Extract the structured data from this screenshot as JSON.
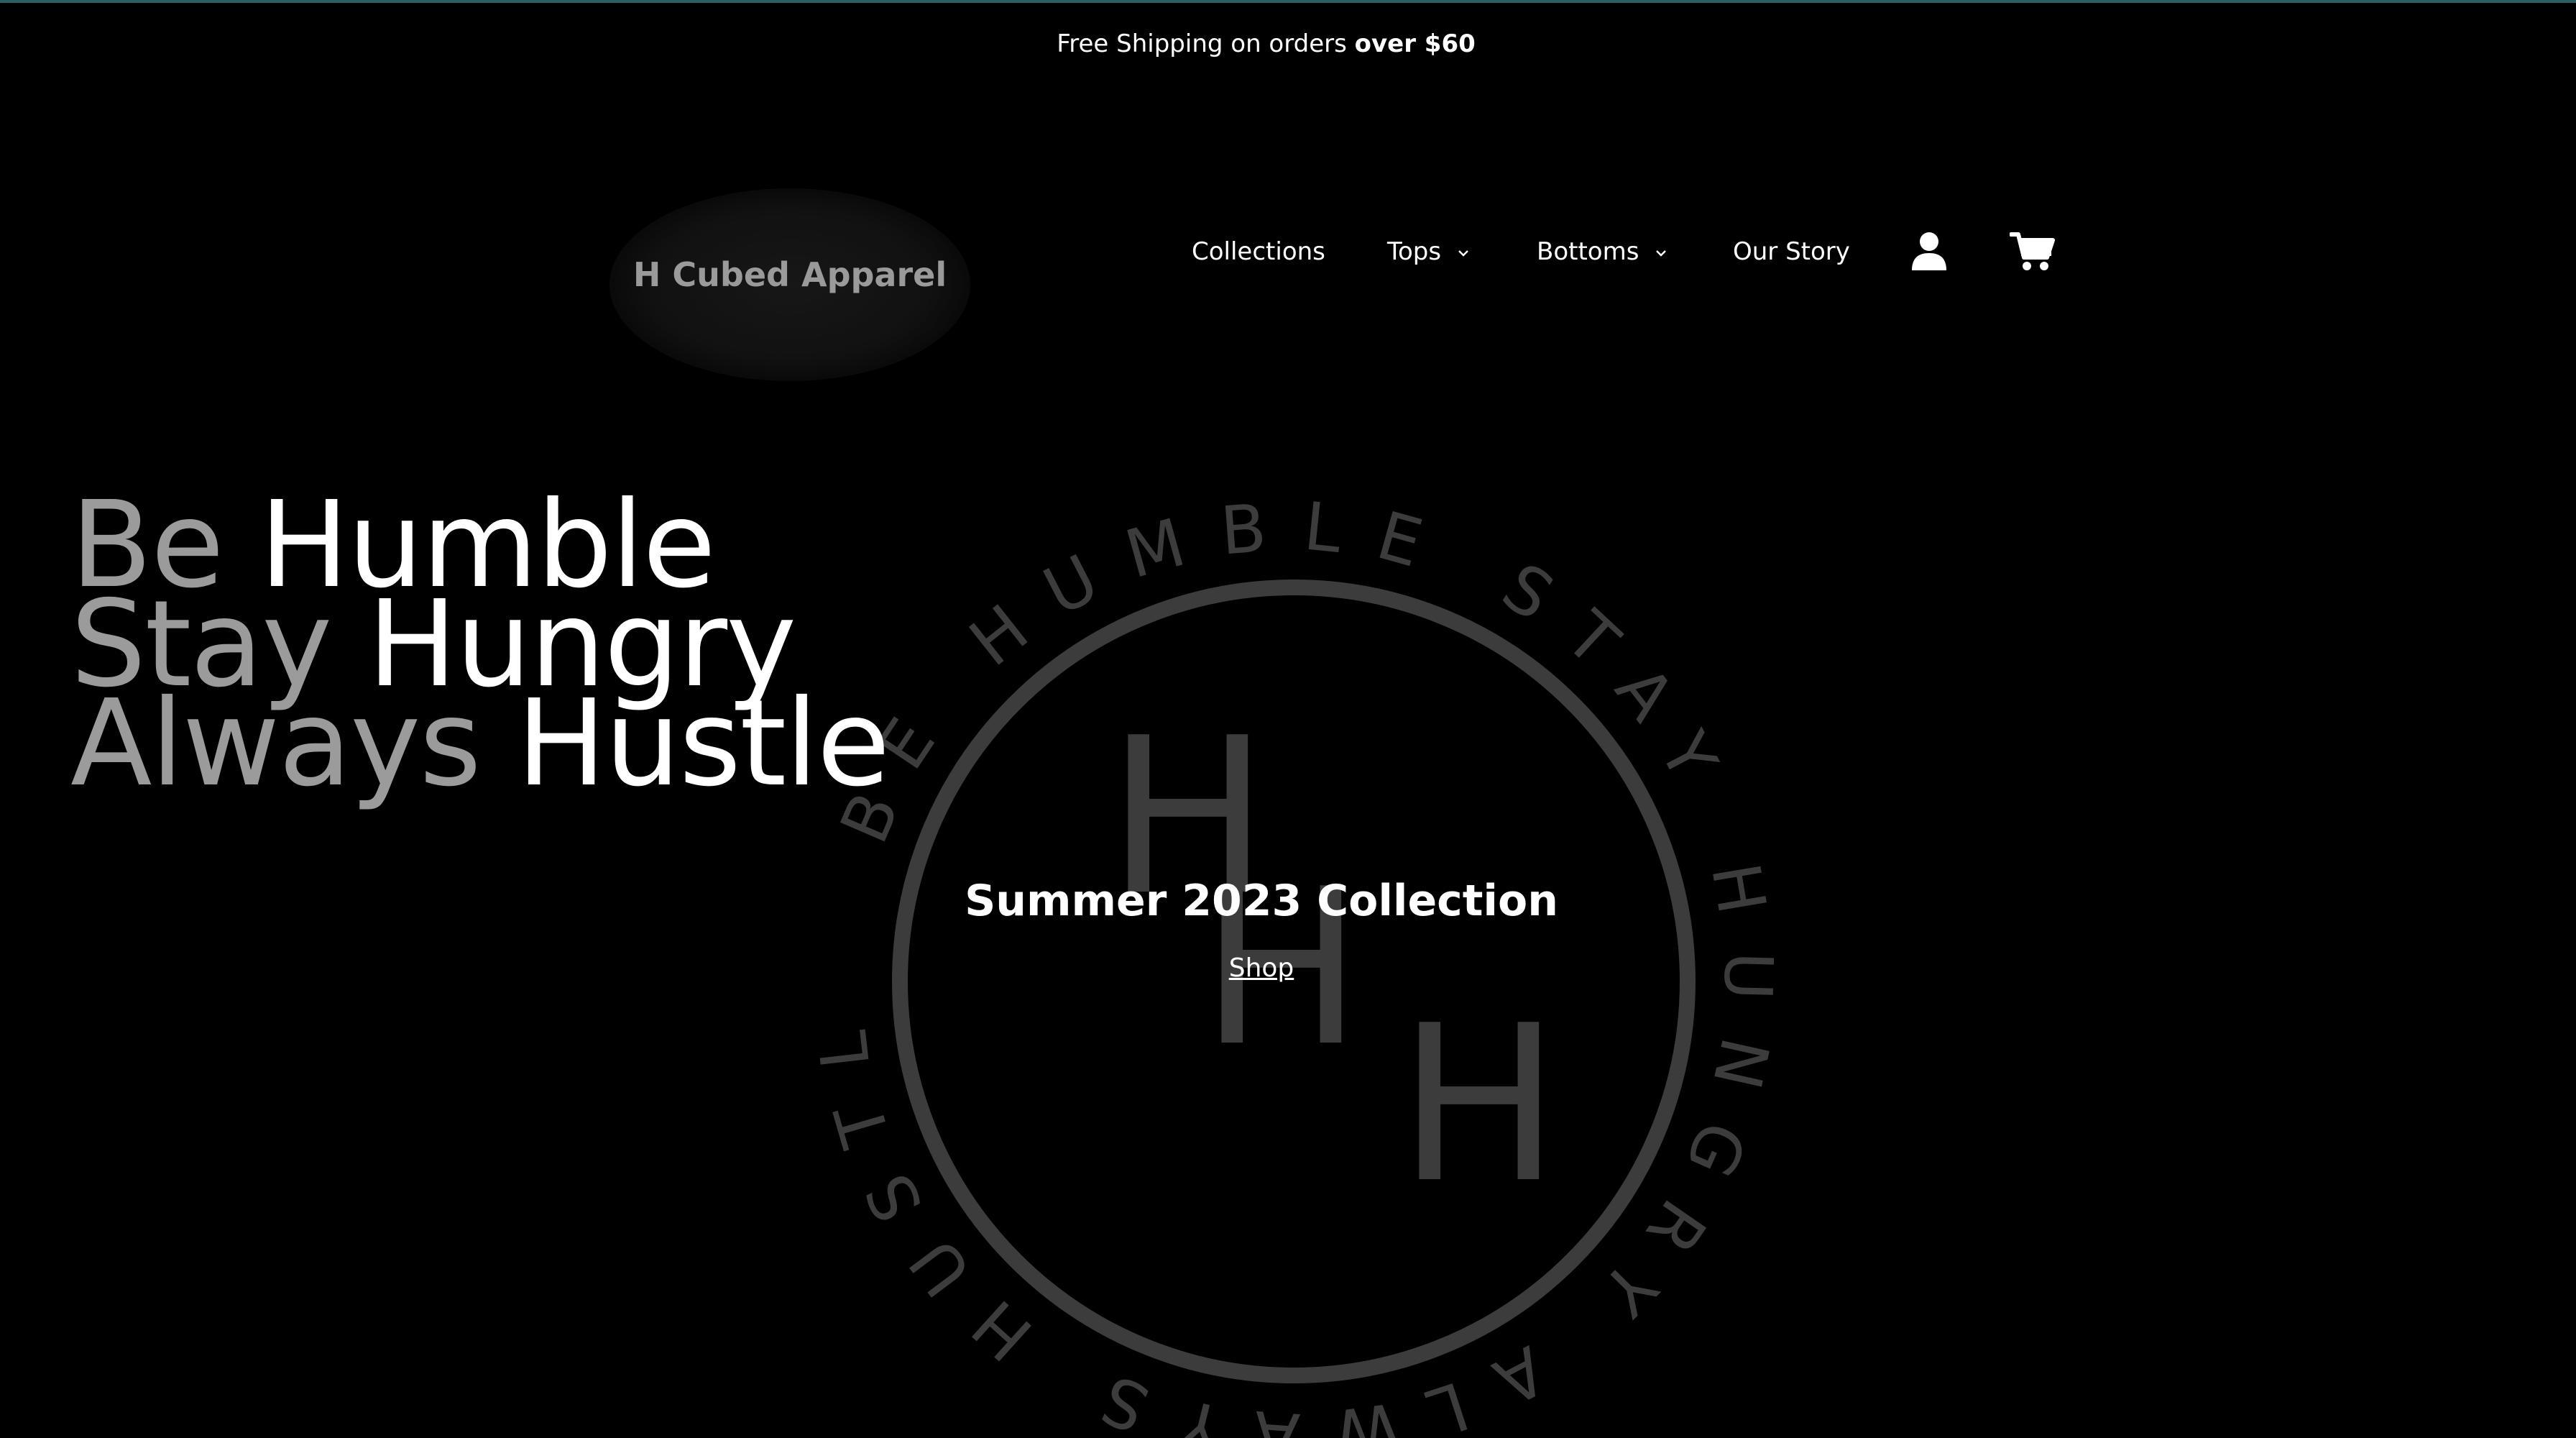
{
  "announcement": {
    "text_prefix": "Free Shipping on orders ",
    "text_bold": "over $60"
  },
  "brand": {
    "name": "H Cubed Apparel"
  },
  "nav": {
    "items": [
      {
        "label": "Collections",
        "has_dropdown": false
      },
      {
        "label": "Tops",
        "has_dropdown": true
      },
      {
        "label": "Bottoms",
        "has_dropdown": true
      },
      {
        "label": "Our Story",
        "has_dropdown": false
      }
    ],
    "account_icon": "user-icon",
    "cart_icon": "cart-icon"
  },
  "hero": {
    "lines": [
      {
        "muted": "Be",
        "bright": "Humble"
      },
      {
        "muted": "Stay",
        "bright": "Hungry"
      },
      {
        "muted": "Always",
        "bright": "Hustle"
      }
    ],
    "emblem": {
      "ring_text": "BE HUMBLE STAY HUNGRY ALWAYS HUSTLE",
      "letters": [
        "H",
        "H",
        "H"
      ]
    },
    "collection_title": "Summer 2023 Collection",
    "shop_label": "Shop"
  },
  "colors": {
    "background": "#000000",
    "text": "#ffffff",
    "muted_text": "#9b9b9b",
    "emblem": "#3c3c3c"
  }
}
